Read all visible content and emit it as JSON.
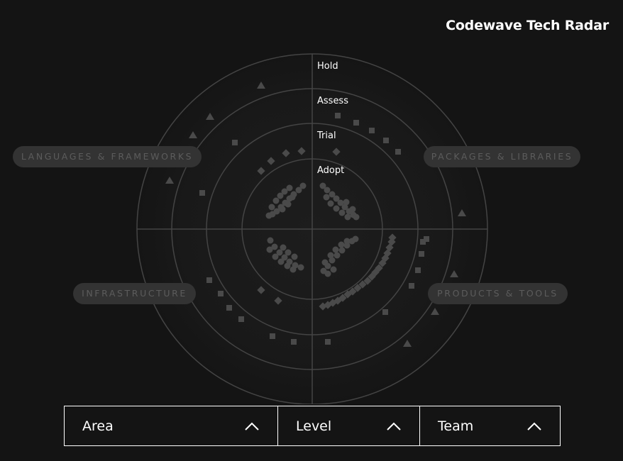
{
  "header": {
    "title": "Codewave Tech Radar"
  },
  "radar": {
    "rings": [
      "Hold",
      "Assess",
      "Trial",
      "Adopt"
    ],
    "quadrants": {
      "top_left": "LANGUAGES & FRAMEWORKS",
      "top_right": "PACKAGES & LIBRARIES",
      "bottom_left": "INFRASTRUCTURE",
      "bottom_right": "PRODUCTS & TOOLS"
    },
    "colors": {
      "blip": "#4a4a4a",
      "ring_line": "#444444",
      "pill_bg": "#333333",
      "pill_text": "#5c5c5c"
    }
  },
  "filters": {
    "area": {
      "label": "Area",
      "icon": "chevron-up-icon"
    },
    "level": {
      "label": "Level",
      "icon": "chevron-up-icon"
    },
    "team": {
      "label": "Team",
      "icon": "chevron-up-icon"
    }
  }
}
